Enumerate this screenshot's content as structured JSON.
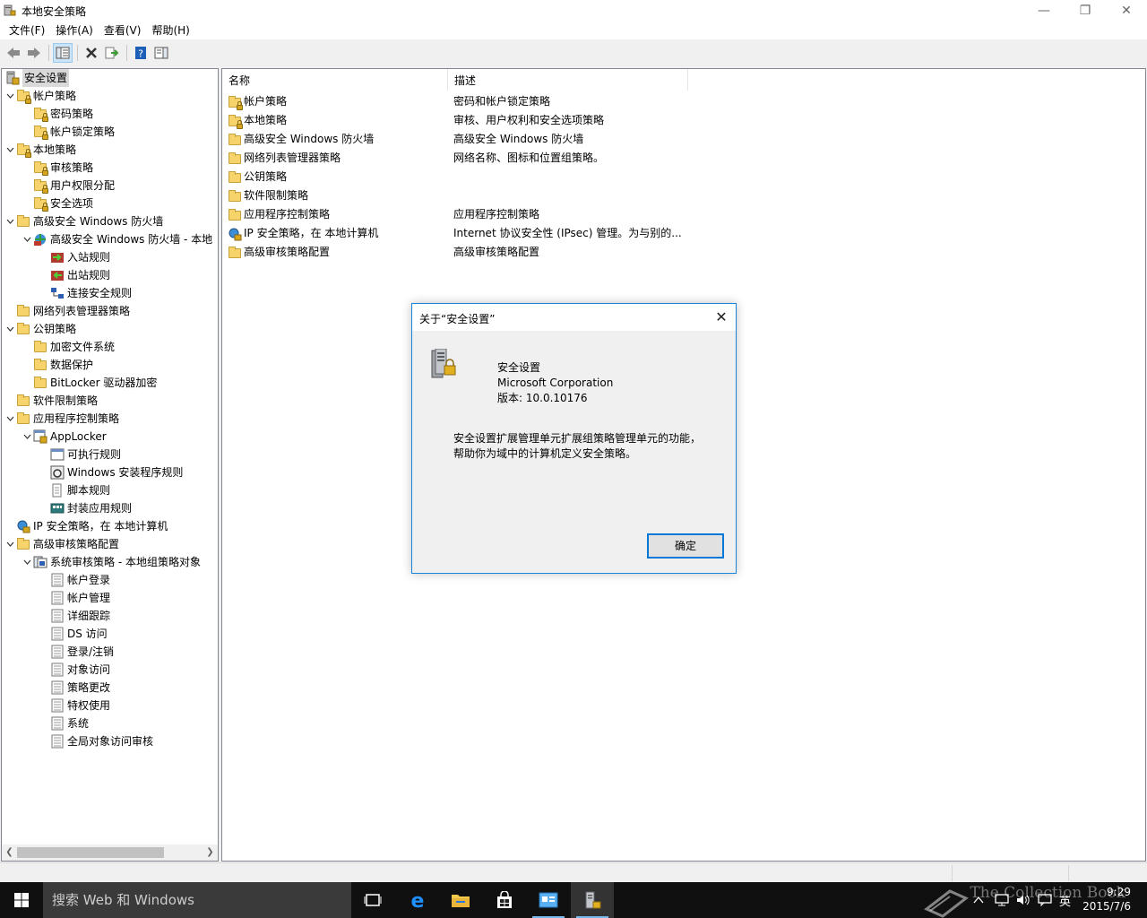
{
  "window": {
    "title": "本地安全策略",
    "minimize": "—",
    "maximize": "❐",
    "close": "✕"
  },
  "menu": [
    "文件(F)",
    "操作(A)",
    "查看(V)",
    "帮助(H)"
  ],
  "tree": {
    "items": [
      {
        "label": "安全设置",
        "level": 0,
        "twisty": "",
        "icon": "security-settings-icon",
        "selected": true
      },
      {
        "label": "帐户策略",
        "level": 0,
        "twisty": "v",
        "icon": "folder-lock-icon"
      },
      {
        "label": "密码策略",
        "level": 1,
        "twisty": "",
        "icon": "folder-lock-icon"
      },
      {
        "label": "帐户锁定策略",
        "level": 1,
        "twisty": "",
        "icon": "folder-lock-icon"
      },
      {
        "label": "本地策略",
        "level": 0,
        "twisty": "v",
        "icon": "folder-lock-icon"
      },
      {
        "label": "审核策略",
        "level": 1,
        "twisty": "",
        "icon": "folder-lock-icon"
      },
      {
        "label": "用户权限分配",
        "level": 1,
        "twisty": "",
        "icon": "folder-lock-icon"
      },
      {
        "label": "安全选项",
        "level": 1,
        "twisty": "",
        "icon": "folder-lock-icon"
      },
      {
        "label": "高级安全 Windows 防火墙",
        "level": 0,
        "twisty": "v",
        "icon": "folder-icon"
      },
      {
        "label": "高级安全 Windows 防火墙 - 本地",
        "level": 1,
        "twisty": "v",
        "icon": "firewall-icon"
      },
      {
        "label": "入站规则",
        "level": 2,
        "twisty": "",
        "icon": "inbound-rules-icon"
      },
      {
        "label": "出站规则",
        "level": 2,
        "twisty": "",
        "icon": "outbound-rules-icon"
      },
      {
        "label": "连接安全规则",
        "level": 2,
        "twisty": "",
        "icon": "connection-rules-icon"
      },
      {
        "label": "网络列表管理器策略",
        "level": 0,
        "twisty": "",
        "icon": "folder-icon"
      },
      {
        "label": "公钥策略",
        "level": 0,
        "twisty": "v",
        "icon": "folder-icon"
      },
      {
        "label": "加密文件系统",
        "level": 1,
        "twisty": "",
        "icon": "folder-icon"
      },
      {
        "label": "数据保护",
        "level": 1,
        "twisty": "",
        "icon": "folder-icon"
      },
      {
        "label": "BitLocker 驱动器加密",
        "level": 1,
        "twisty": "",
        "icon": "folder-icon"
      },
      {
        "label": "软件限制策略",
        "level": 0,
        "twisty": "",
        "icon": "folder-icon"
      },
      {
        "label": "应用程序控制策略",
        "level": 0,
        "twisty": "v",
        "icon": "folder-icon"
      },
      {
        "label": "AppLocker",
        "level": 1,
        "twisty": "v",
        "icon": "applocker-icon"
      },
      {
        "label": "可执行规则",
        "level": 2,
        "twisty": "",
        "icon": "executable-rules-icon"
      },
      {
        "label": "Windows 安装程序规则",
        "level": 2,
        "twisty": "",
        "icon": "installer-rules-icon"
      },
      {
        "label": "脚本规则",
        "level": 2,
        "twisty": "",
        "icon": "script-rules-icon"
      },
      {
        "label": "封装应用规则",
        "level": 2,
        "twisty": "",
        "icon": "packaged-app-rules-icon"
      },
      {
        "label": "IP 安全策略，在 本地计算机",
        "level": 0,
        "twisty": "",
        "icon": "ipsec-icon"
      },
      {
        "label": "高级审核策略配置",
        "level": 0,
        "twisty": "v",
        "icon": "folder-icon"
      },
      {
        "label": "系统审核策略 - 本地组策略对象",
        "level": 1,
        "twisty": "v",
        "icon": "audit-policy-icon"
      },
      {
        "label": "帐户登录",
        "level": 2,
        "twisty": "",
        "icon": "audit-item-icon"
      },
      {
        "label": "帐户管理",
        "level": 2,
        "twisty": "",
        "icon": "audit-item-icon"
      },
      {
        "label": "详细跟踪",
        "level": 2,
        "twisty": "",
        "icon": "audit-item-icon"
      },
      {
        "label": "DS 访问",
        "level": 2,
        "twisty": "",
        "icon": "audit-item-icon"
      },
      {
        "label": "登录/注销",
        "level": 2,
        "twisty": "",
        "icon": "audit-item-icon"
      },
      {
        "label": "对象访问",
        "level": 2,
        "twisty": "",
        "icon": "audit-item-icon"
      },
      {
        "label": "策略更改",
        "level": 2,
        "twisty": "",
        "icon": "audit-item-icon"
      },
      {
        "label": "特权使用",
        "level": 2,
        "twisty": "",
        "icon": "audit-item-icon"
      },
      {
        "label": "系统",
        "level": 2,
        "twisty": "",
        "icon": "audit-item-icon"
      },
      {
        "label": "全局对象访问审核",
        "level": 2,
        "twisty": "",
        "icon": "audit-item-icon"
      }
    ]
  },
  "list": {
    "columns": [
      "名称",
      "描述"
    ],
    "rows": [
      {
        "name": "帐户策略",
        "desc": "密码和帐户锁定策略",
        "icon": "folder-lock-icon"
      },
      {
        "name": "本地策略",
        "desc": "审核、用户权利和安全选项策略",
        "icon": "folder-lock-icon"
      },
      {
        "name": "高级安全 Windows 防火墙",
        "desc": "高级安全 Windows 防火墙",
        "icon": "folder-icon"
      },
      {
        "name": "网络列表管理器策略",
        "desc": "网络名称、图标和位置组策略。",
        "icon": "folder-icon"
      },
      {
        "name": "公钥策略",
        "desc": "",
        "icon": "folder-icon"
      },
      {
        "name": "软件限制策略",
        "desc": "",
        "icon": "folder-icon"
      },
      {
        "name": "应用程序控制策略",
        "desc": "应用程序控制策略",
        "icon": "folder-icon"
      },
      {
        "name": "IP 安全策略，在 本地计算机",
        "desc": "Internet 协议安全性 (IPsec) 管理。为与别的...",
        "icon": "ipsec-icon"
      },
      {
        "name": "高级审核策略配置",
        "desc": "高级审核策略配置",
        "icon": "folder-icon"
      }
    ]
  },
  "dialog": {
    "title": "关于“安全设置”",
    "product": "安全设置",
    "company": "Microsoft Corporation",
    "version": "版本: 10.0.10176",
    "description_line1": "安全设置扩展管理单元扩展组策略管理单元的功能，",
    "description_line2": "帮助你为域中的计算机定义安全策略。",
    "ok": "确定",
    "close": "✕"
  },
  "taskbar": {
    "search_placeholder": "搜索 Web 和 Windows",
    "time": "9:29",
    "date": "2015/7/6",
    "ime": "英",
    "watermark": "The Collection Book"
  },
  "colors": {
    "accent": "#0078d7",
    "folder": "#f6d36b",
    "taskbar": "#101010"
  }
}
